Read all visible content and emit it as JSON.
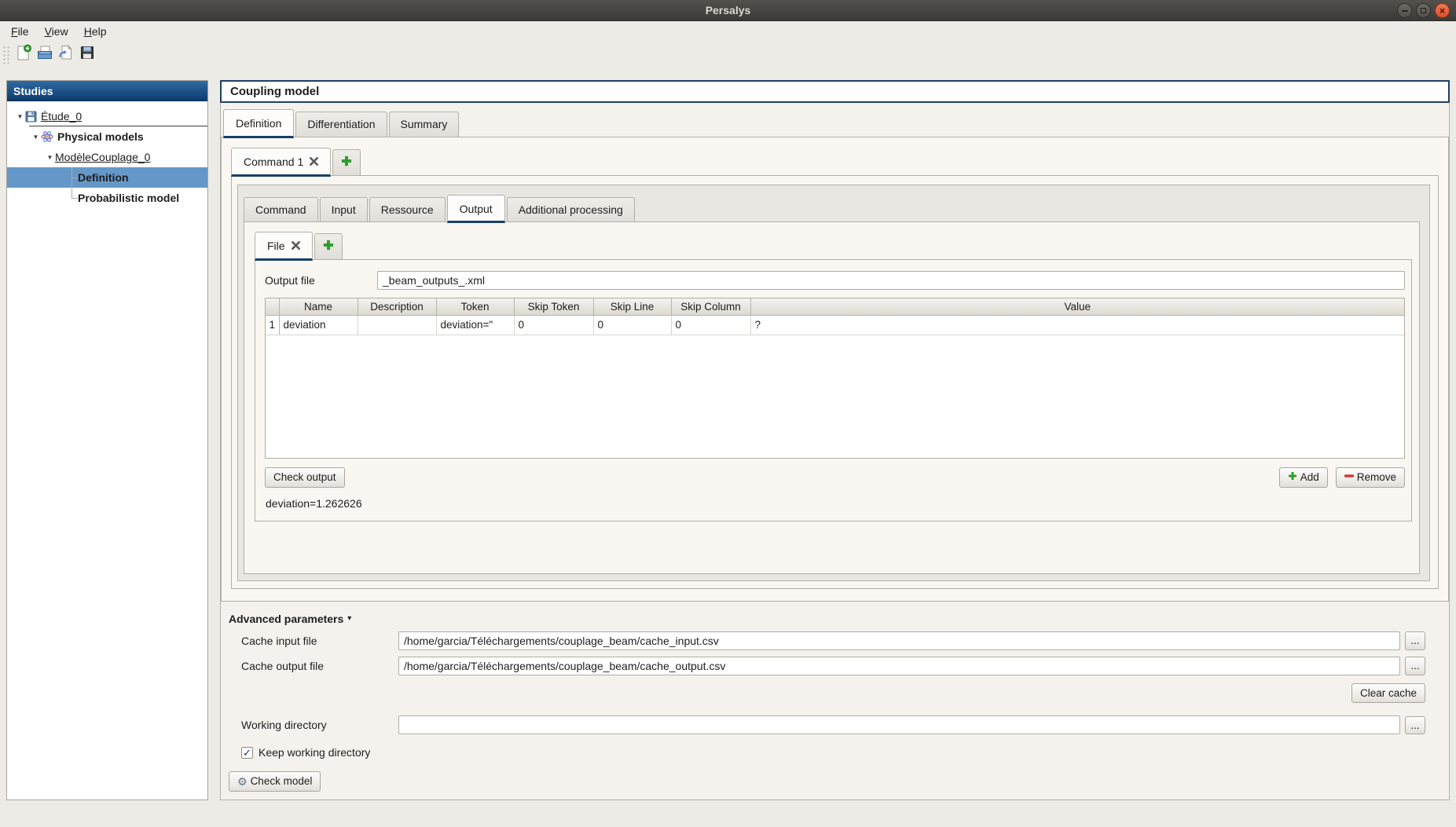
{
  "titlebar": {
    "title": "Persalys"
  },
  "menubar": {
    "items": [
      "File",
      "View",
      "Help"
    ]
  },
  "toolbar": {
    "buttons": [
      "new-study",
      "open-study",
      "export-script",
      "save-study"
    ]
  },
  "glyphs": {
    "tree_arrow": "▼",
    "collapse_arrow": "▾",
    "check": "✓",
    "gear": "⚙",
    "close": "×"
  },
  "colors": {
    "accent_navy": "#16406b",
    "selection_blue": "#6598c8",
    "studies_header_top": "#2e6aa3",
    "studies_header_bottom": "#0d3c6d",
    "add_green": "#3fa02f",
    "remove_red": "#cf3b30",
    "close_button_orange": "#dd4f2c"
  },
  "sidebar": {
    "header": "Studies",
    "tree": [
      {
        "label": "Étude_0"
      },
      {
        "label": "Physical models"
      },
      {
        "label": "ModèleCouplage_0"
      },
      {
        "label": "Definition"
      },
      {
        "label": "Probabilistic model"
      }
    ]
  },
  "main": {
    "title": "Coupling model",
    "tabs": [
      "Definition",
      "Differentiation",
      "Summary"
    ],
    "command_tab": "Command 1",
    "subtabs": [
      "Command",
      "Input",
      "Ressource",
      "Output",
      "Additional processing"
    ],
    "file_tab": "File",
    "output_file": {
      "label": "Output file",
      "value": "_beam_outputs_.xml"
    },
    "table": {
      "columns": [
        "Name",
        "Description",
        "Token",
        "Skip Token",
        "Skip Line",
        "Skip Column",
        "Value"
      ],
      "rows": [
        {
          "num": "1",
          "name": "deviation",
          "description": "",
          "token": "deviation=\"",
          "skip_token": "0",
          "skip_line": "0",
          "skip_column": "0",
          "value": "?"
        }
      ]
    },
    "buttons": {
      "check_output": "Check output",
      "add": "Add",
      "remove": "Remove",
      "clear_cache": "Clear cache",
      "check_model": "Check model",
      "browse": "..."
    },
    "result_text": "deviation=1.262626",
    "advanced": {
      "title": "Advanced parameters",
      "cache_input_label": "Cache input file",
      "cache_input_value": "/home/garcia/Téléchargements/couplage_beam/cache_input.csv",
      "cache_output_label": "Cache output file",
      "cache_output_value": "/home/garcia/Téléchargements/couplage_beam/cache_output.csv",
      "working_dir_label": "Working directory",
      "working_dir_value": "",
      "keep_working_dir": "Keep working directory"
    }
  }
}
